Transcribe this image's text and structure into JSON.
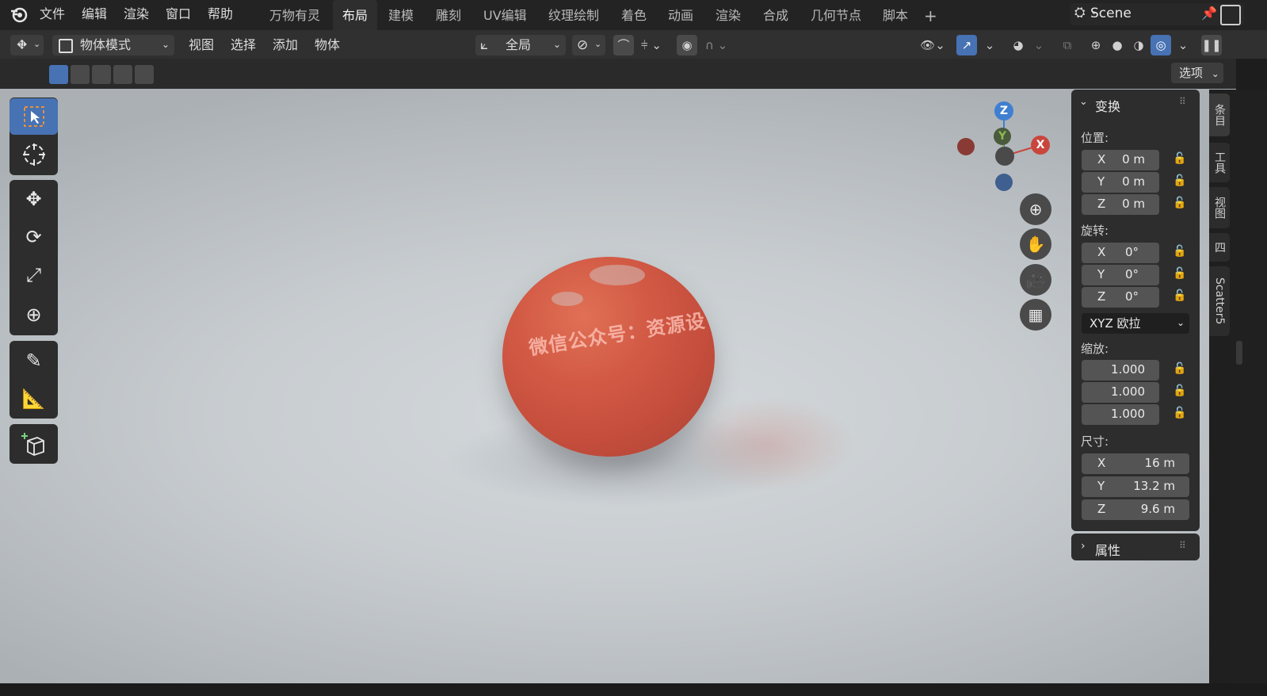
{
  "app": {
    "menu": [
      "文件",
      "编辑",
      "渲染",
      "窗口",
      "帮助"
    ],
    "workspaces": [
      "万物有灵",
      "布局",
      "建模",
      "雕刻",
      "UV编辑",
      "纹理绘制",
      "着色",
      "动画",
      "渲染",
      "合成",
      "几何节点",
      "脚本"
    ],
    "active_workspace": "布局",
    "add_tab": "+",
    "scene_name": "Scene"
  },
  "header": {
    "mode": "物体模式",
    "menus": [
      "视图",
      "选择",
      "添加",
      "物体"
    ],
    "transform_orientation": "全局",
    "options_label": "选项"
  },
  "viewport": {
    "watermark": "微信公众号：资源设",
    "gizmo": {
      "z": "Z",
      "x": "X",
      "y": "Y"
    }
  },
  "sidebar": {
    "transform_title": "变换",
    "location_label": "位置:",
    "location": [
      {
        "axis": "X",
        "value": "0 m"
      },
      {
        "axis": "Y",
        "value": "0 m"
      },
      {
        "axis": "Z",
        "value": "0 m"
      }
    ],
    "rotation_label": "旋转:",
    "rotation": [
      {
        "axis": "X",
        "value": "0°"
      },
      {
        "axis": "Y",
        "value": "0°"
      },
      {
        "axis": "Z",
        "value": "0°"
      }
    ],
    "rotation_mode": "XYZ 欧拉",
    "scale_label": "缩放:",
    "scale": [
      "1.000",
      "1.000",
      "1.000"
    ],
    "dimensions_label": "尺寸:",
    "dimensions": [
      {
        "axis": "X",
        "value": "16 m"
      },
      {
        "axis": "Y",
        "value": "13.2 m"
      },
      {
        "axis": "Z",
        "value": "9.6 m"
      }
    ],
    "properties_title": "属性",
    "tabs": [
      "条目",
      "工具",
      "视图",
      "四",
      "Scatter5"
    ]
  },
  "colors": {
    "accent": "#4772b3",
    "orange": "#d25a45",
    "x_axis": "#c9463d",
    "z_axis": "#3f7fd1"
  }
}
